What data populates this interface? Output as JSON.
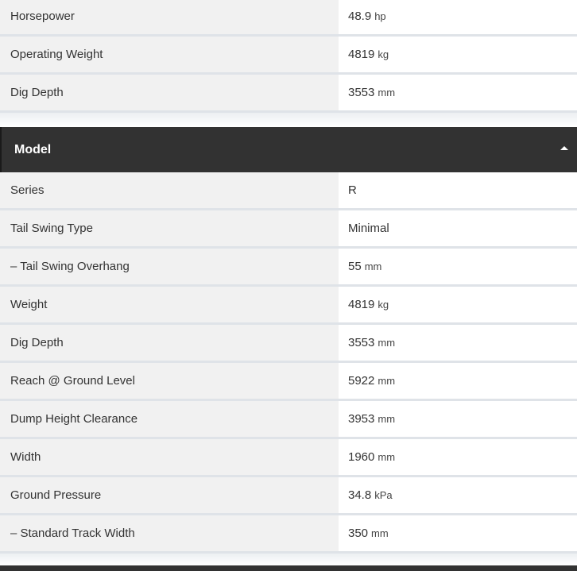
{
  "top_specs": [
    {
      "label": "Horsepower",
      "value": "48.9",
      "unit": "hp"
    },
    {
      "label": "Operating Weight",
      "value": "4819",
      "unit": "kg"
    },
    {
      "label": "Dig Depth",
      "value": "3553",
      "unit": "mm"
    }
  ],
  "model_section": {
    "title": "Model",
    "specs": [
      {
        "label": "Series",
        "value": "R",
        "unit": ""
      },
      {
        "label": "Tail Swing Type",
        "value": "Minimal",
        "unit": ""
      },
      {
        "label": "– Tail Swing Overhang",
        "value": "55",
        "unit": "mm"
      },
      {
        "label": "Weight",
        "value": "4819",
        "unit": "kg"
      },
      {
        "label": "Dig Depth",
        "value": "3553",
        "unit": "mm"
      },
      {
        "label": "Reach @ Ground Level",
        "value": "5922",
        "unit": "mm"
      },
      {
        "label": "Dump Height Clearance",
        "value": "3953",
        "unit": "mm"
      },
      {
        "label": "Width",
        "value": "1960",
        "unit": "mm"
      },
      {
        "label": "Ground Pressure",
        "value": "34.8",
        "unit": "kPa"
      },
      {
        "label": "– Standard Track Width",
        "value": "350",
        "unit": "mm"
      }
    ]
  }
}
